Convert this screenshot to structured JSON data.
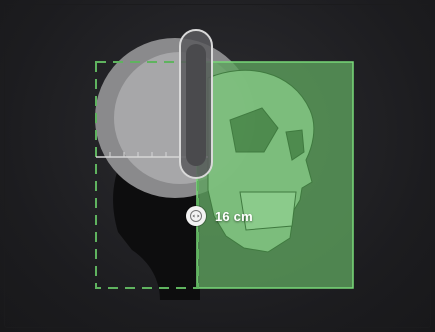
{
  "measurement": {
    "value_label": "16 cm"
  },
  "icons": {
    "measure_handle": "horizontal-arrows-icon",
    "ear_rod": "ear-rod-icon"
  },
  "colors": {
    "background": "#1c1c1f",
    "detector_fill": "#5ea35e",
    "detector_border": "#6fd06f",
    "dashed_outline": "#5fb35f",
    "head_silhouette": "#0f0f10",
    "skull_gray": "#9c9c9c"
  }
}
